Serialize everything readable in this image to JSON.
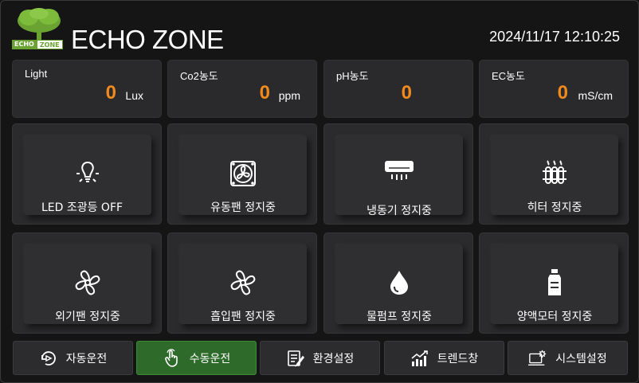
{
  "header": {
    "brand": "ECHO ZONE",
    "logo_badge_left": "ECHO",
    "logo_badge_right": "ZONE",
    "datetime": "2024/11/17 12:10:25"
  },
  "sensors": [
    {
      "label": "Light",
      "value": "0",
      "unit": "Lux"
    },
    {
      "label": "Co2농도",
      "value": "0",
      "unit": "ppm"
    },
    {
      "label": "pH농도",
      "value": "0",
      "unit": ""
    },
    {
      "label": "EC농도",
      "value": "0",
      "unit": "mS/cm"
    }
  ],
  "devices": [
    {
      "label": "LED 조광등  OFF",
      "icon": "bulb-icon"
    },
    {
      "label": "유동팬 정지중",
      "icon": "fan-box-icon"
    },
    {
      "label": "냉동기 정지중",
      "icon": "air-conditioner-icon"
    },
    {
      "label": "히터 정지중",
      "icon": "heater-icon"
    },
    {
      "label": "외기팬 정지중",
      "icon": "fan-icon"
    },
    {
      "label": "흡입팬 정지중",
      "icon": "fan-icon"
    },
    {
      "label": "물펌프 정지중",
      "icon": "water-drop-icon"
    },
    {
      "label": "양액모터 정지중",
      "icon": "bottle-icon"
    }
  ],
  "nav": [
    {
      "label": "자동운전",
      "icon": "auto-icon",
      "active": false
    },
    {
      "label": "수동운전",
      "icon": "hand-pointer-icon",
      "active": true
    },
    {
      "label": "환경설정",
      "icon": "settings-doc-icon",
      "active": false
    },
    {
      "label": "트렌드창",
      "icon": "trend-chart-icon",
      "active": false
    },
    {
      "label": "시스템설정",
      "icon": "system-settings-icon",
      "active": false
    }
  ],
  "colors": {
    "value_accent": "#f08a1c",
    "active_nav": "#2e6b2a",
    "logo_green": "#6aa332"
  }
}
